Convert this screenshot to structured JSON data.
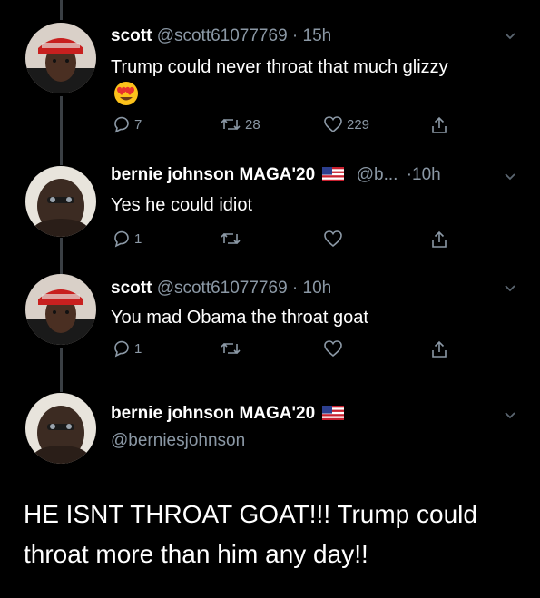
{
  "tweets": [
    {
      "name": "scott",
      "handle": "@scott61077769",
      "dot": "·",
      "time": "15h",
      "text": "Trump could never throat that much glizzy",
      "emoji": "😍",
      "emoji_name": "heart-eyes-emoji",
      "replies": "7",
      "retweets": "28",
      "likes": "229"
    },
    {
      "name": "bernie johnson MAGA'20",
      "handle": "@b...",
      "dot": "·",
      "time": "10h",
      "text": "Yes he could idiot",
      "replies": "1",
      "retweets": "",
      "likes": ""
    },
    {
      "name": "scott",
      "handle": "@scott61077769",
      "dot": "·",
      "time": "10h",
      "text": "You mad Obama the throat goat",
      "replies": "1",
      "retweets": "",
      "likes": ""
    }
  ],
  "main_tweet": {
    "name": "bernie johnson MAGA'20",
    "handle": "@berniesjohnson",
    "text": "HE ISNT THROAT GOAT!!! Trump could throat more than him any day!!"
  },
  "icons": {
    "reply": "reply-icon",
    "retweet": "retweet-icon",
    "like": "heart-icon",
    "share": "share-icon",
    "more": "chevron-down-icon",
    "flag": "us-flag-icon"
  },
  "colors": {
    "background": "#000000",
    "text": "#ffffff",
    "secondary": "#8b98a5",
    "thread_line": "#3a3f44"
  }
}
